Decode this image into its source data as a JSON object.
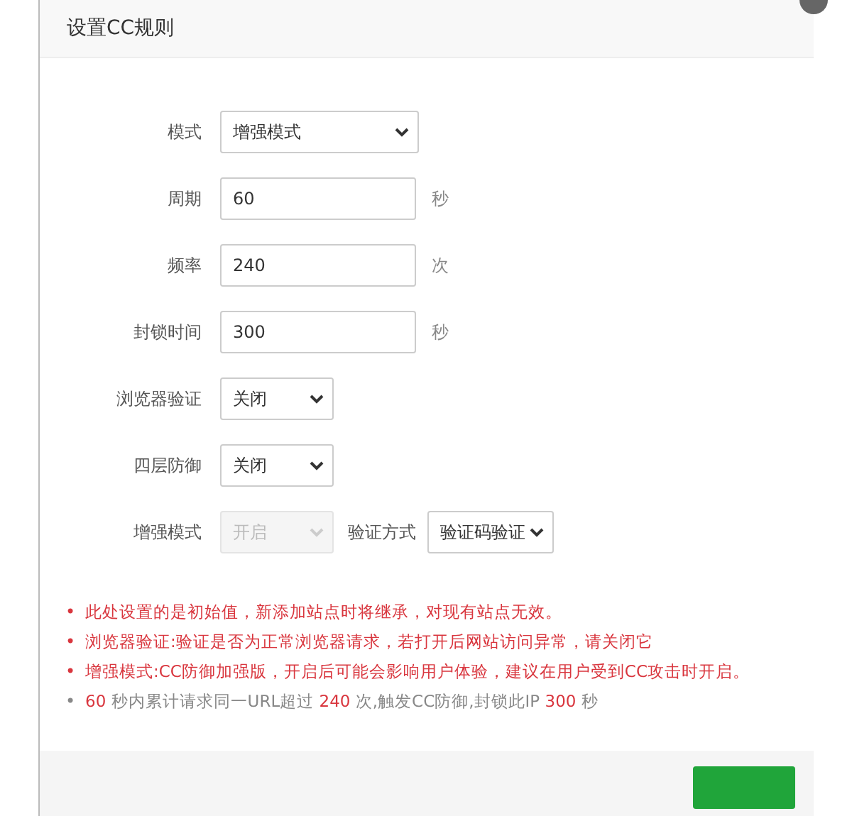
{
  "dialog": {
    "title": "设置CC规则"
  },
  "fields": [
    {
      "kind": "wide-select",
      "label": "模式",
      "value": "增强模式",
      "disabled": false
    },
    {
      "kind": "input",
      "label": "周期",
      "value": "60",
      "unit": "秒"
    },
    {
      "kind": "input",
      "label": "频率",
      "value": "240",
      "unit": "次"
    },
    {
      "kind": "input",
      "label": "封锁时间",
      "value": "300",
      "unit": "秒"
    },
    {
      "kind": "select",
      "label": "浏览器验证",
      "value": "关闭",
      "disabled": false
    },
    {
      "kind": "select",
      "label": "四层防御",
      "value": "关闭",
      "disabled": false
    },
    {
      "kind": "select",
      "label": "增强模式",
      "value": "开启",
      "disabled": true,
      "extra_label": "验证方式",
      "extra_value": "验证码验证"
    }
  ],
  "notes": [
    {
      "kind": "warning",
      "bullet": "•",
      "text": "此处设置的是初始值，新添加站点时将继承，对现有站点无效。"
    },
    {
      "kind": "warning",
      "bullet": "•",
      "text": "浏览器验证:验证是否为正常浏览器请求，若打开后网站访问异常，请关闭它"
    },
    {
      "kind": "warning",
      "bullet": "•",
      "text": "增强模式:CC防御加强版，开启后可能会影响用户体验，建议在用户受到CC攻击时开启。"
    },
    {
      "kind": "summary",
      "bullet": "•",
      "segments": [
        {
          "text": "60",
          "highlight": true
        },
        {
          "text": " 秒内累计请求同一URL超过 ",
          "highlight": false
        },
        {
          "text": "240",
          "highlight": true
        },
        {
          "text": " 次,触发CC防御,封锁此IP ",
          "highlight": false
        },
        {
          "text": "300",
          "highlight": true
        },
        {
          "text": " 秒",
          "highlight": false
        }
      ]
    }
  ]
}
